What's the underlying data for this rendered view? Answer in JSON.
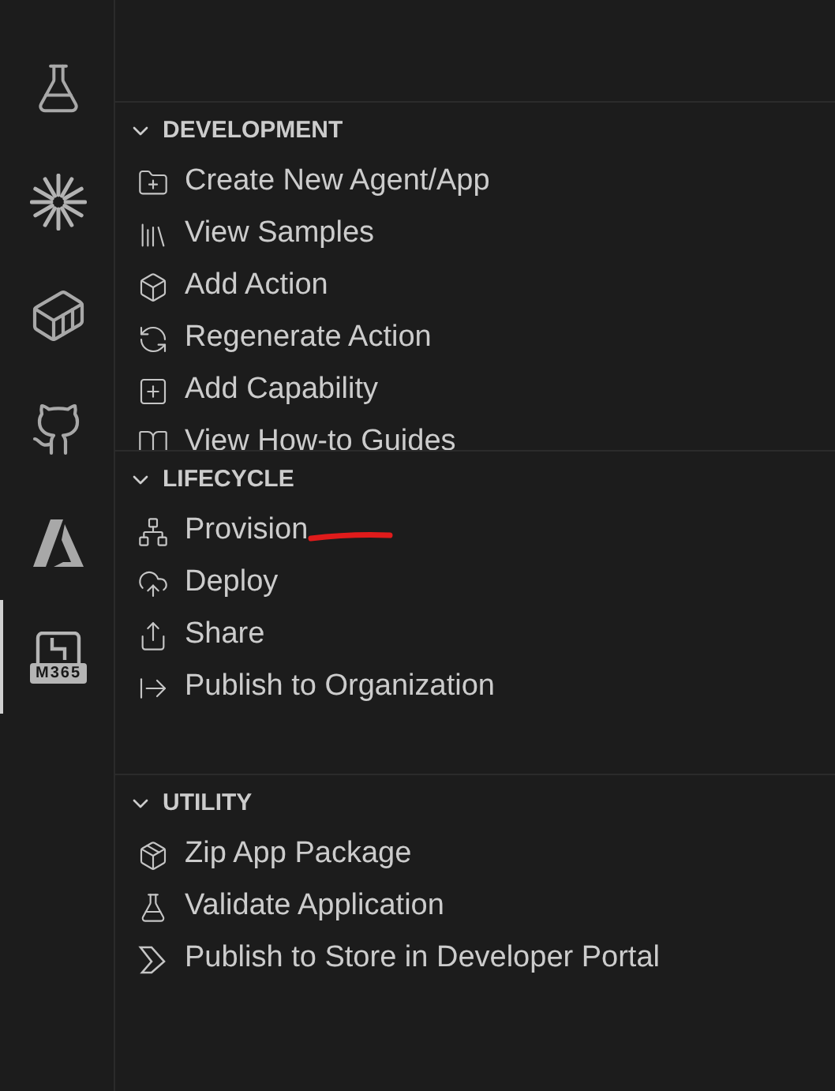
{
  "activity_bar": [
    {
      "selected": false
    },
    {
      "selected": false
    },
    {
      "selected": false
    },
    {
      "selected": false
    },
    {
      "selected": false
    },
    {
      "selected": true,
      "label": "M365"
    }
  ],
  "sections": [
    {
      "title": "DEVELOPMENT",
      "expanded": true,
      "items": [
        "Create New Agent/App",
        "View Samples",
        "Add Action",
        "Regenerate Action",
        "Add Capability",
        "View How-to Guides"
      ]
    },
    {
      "title": "LIFECYCLE",
      "expanded": true,
      "items": [
        "Provision",
        "Deploy",
        "Share",
        "Publish to Organization"
      ]
    },
    {
      "title": "UTILITY",
      "expanded": true,
      "items": [
        "Zip App Package",
        "Validate Application",
        "Publish to Store in Developer Portal"
      ]
    }
  ]
}
